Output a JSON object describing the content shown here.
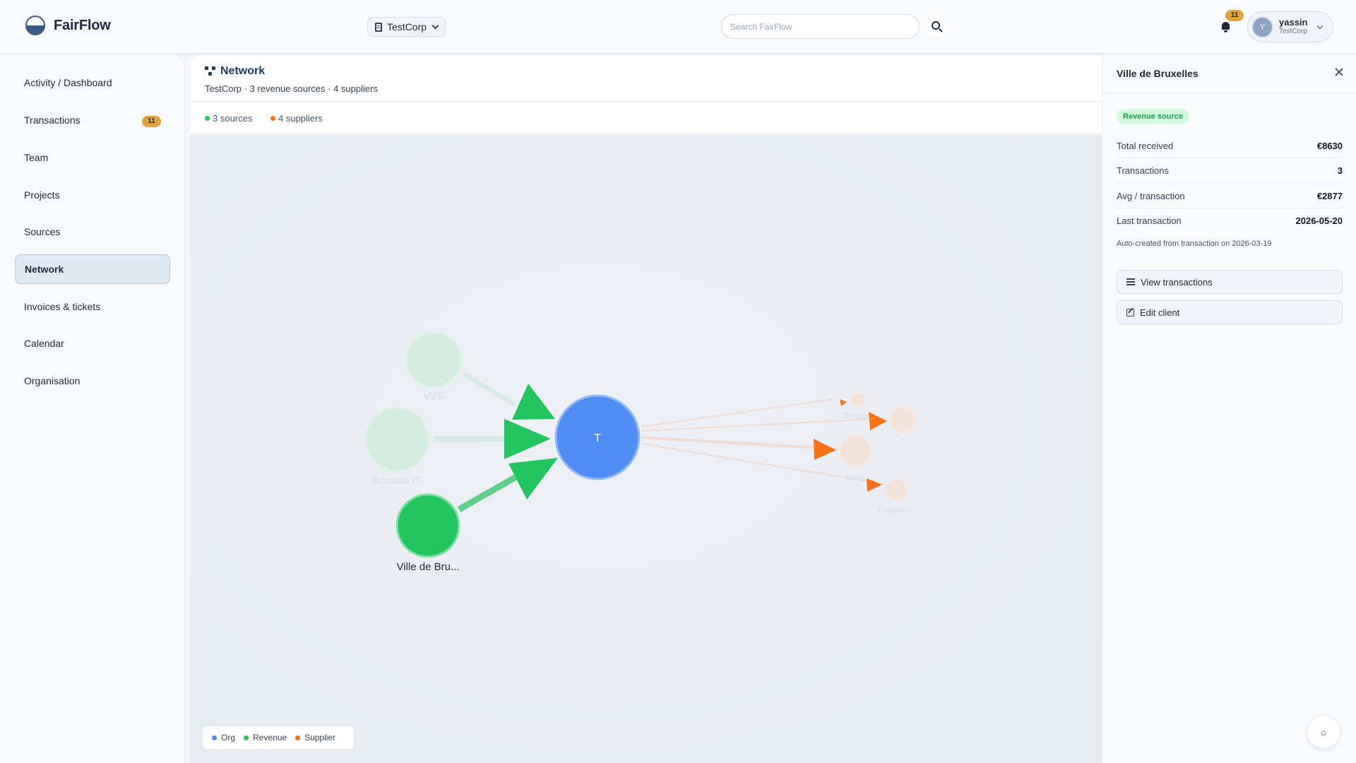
{
  "app": {
    "name": "FairFlow"
  },
  "header": {
    "org_selector": "TestCorp",
    "search_placeholder": "Search FairFlow",
    "notifications_count": "11",
    "user": {
      "name": "yassin",
      "org": "TestCorp",
      "initial": "Y"
    }
  },
  "sidebar": {
    "items": [
      {
        "label": "Activity / Dashboard"
      },
      {
        "label": "Transactions",
        "badge": "11"
      },
      {
        "label": "Team"
      },
      {
        "label": "Projects"
      },
      {
        "label": "Sources"
      },
      {
        "label": "Network",
        "active": true
      },
      {
        "label": "Invoices & tickets"
      },
      {
        "label": "Calendar"
      },
      {
        "label": "Organisation"
      }
    ]
  },
  "main": {
    "title": "Network",
    "subtitle": "TestCorp · 3 revenue sources · 4 suppliers",
    "stats": {
      "sources": "3 sources",
      "separator": "·",
      "suppliers": "4 suppliers"
    },
    "graph": {
      "center": {
        "label": "T"
      },
      "sources": [
        {
          "name": "VVS"
        },
        {
          "name": "Bonaub IT"
        },
        {
          "name": "Ville de Bru..."
        }
      ],
      "suppliers": [
        {
          "name": "Thoma..."
        },
        {
          "name": "?"
        },
        {
          "name": "None"
        },
        {
          "name": "Carrefour"
        }
      ]
    },
    "legend": {
      "org": "Org",
      "revenue": "Revenue",
      "supplier": "Supplier"
    }
  },
  "panel": {
    "title": "Ville de Bruxelles",
    "tag": "Revenue source",
    "rows": [
      {
        "key": "Total received",
        "value": "€8630"
      },
      {
        "key": "Transactions",
        "value": "3"
      },
      {
        "key": "Avg / transaction",
        "value": "€2877"
      },
      {
        "key": "Last transaction",
        "value": "2026-05-20"
      }
    ],
    "note": "Auto-created from transaction on 2026-03-19",
    "buttons": {
      "view": "View transactions",
      "edit": "Edit client"
    }
  },
  "colors": {
    "org": "#4f8ef5",
    "revenue": "#22c55e",
    "supplier": "#f97316",
    "badge": "#e2a33c"
  }
}
